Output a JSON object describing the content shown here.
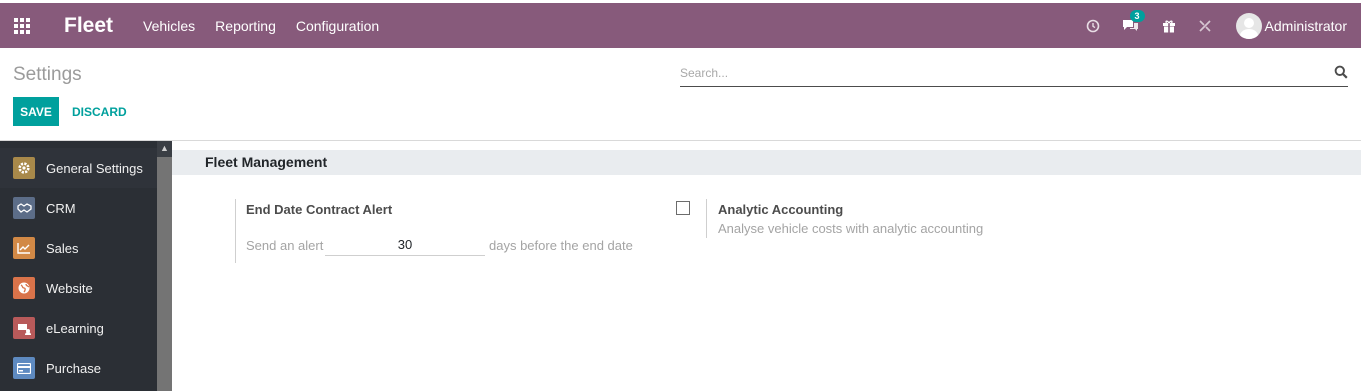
{
  "navbar": {
    "brand": "Fleet",
    "menu": [
      "Vehicles",
      "Reporting",
      "Configuration"
    ],
    "notification_count": "3",
    "user": "Administrator",
    "color": "#875a7b"
  },
  "control_panel": {
    "title": "Settings",
    "search_placeholder": "Search...",
    "save_label": "SAVE",
    "discard_label": "DISCARD"
  },
  "sidebar": {
    "items": [
      {
        "label": "General Settings",
        "icon": "gear-icon",
        "color": "#a8894a"
      },
      {
        "label": "CRM",
        "icon": "handshake-icon",
        "color": "#5c6d88"
      },
      {
        "label": "Sales",
        "icon": "chart-icon",
        "color": "#d28946"
      },
      {
        "label": "Website",
        "icon": "globe-icon",
        "color": "#d9734a"
      },
      {
        "label": "eLearning",
        "icon": "elearning-icon",
        "color": "#b85a5a"
      },
      {
        "label": "Purchase",
        "icon": "credit-card-icon",
        "color": "#5e8ac0"
      }
    ]
  },
  "main": {
    "section_title": "Fleet Management",
    "contract_alert": {
      "title": "End Date Contract Alert",
      "prefix": "Send an alert",
      "value": "30",
      "suffix": "days before the end date"
    },
    "analytic": {
      "title": "Analytic Accounting",
      "description": "Analyse vehicle costs with analytic accounting",
      "checked": false
    }
  },
  "colors": {
    "accent": "#00a09d",
    "sidebar_bg": "#2b2f35",
    "section_bg": "#e9ecef"
  }
}
